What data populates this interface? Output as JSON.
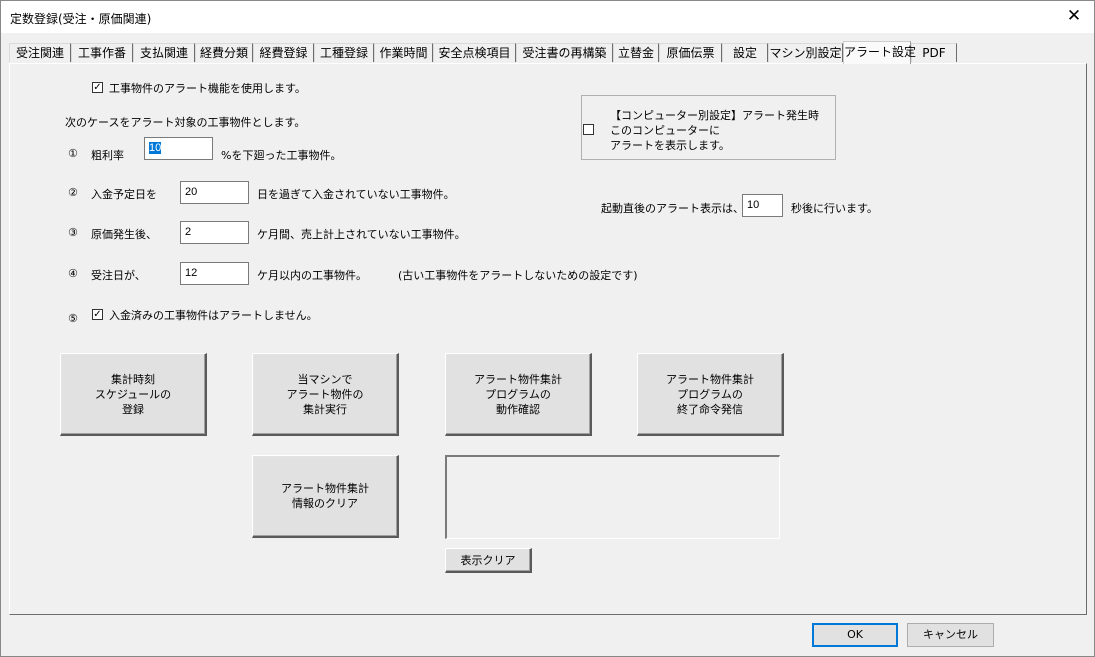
{
  "window": {
    "title": "定数登録(受注・原価関連)",
    "close_glyph": "✕"
  },
  "tabs": [
    {
      "label": "受注関連"
    },
    {
      "label": "工事作番"
    },
    {
      "label": "支払関連"
    },
    {
      "label": "経費分類"
    },
    {
      "label": "経費登録"
    },
    {
      "label": "工種登録"
    },
    {
      "label": "作業時間"
    },
    {
      "label": "安全点検項目"
    },
    {
      "label": "受注書の再構築"
    },
    {
      "label": "立替金"
    },
    {
      "label": "原価伝票"
    },
    {
      "label": "設定"
    },
    {
      "label": "マシン別設定"
    },
    {
      "label": "アラート設定",
      "active": true
    },
    {
      "label": "PDF"
    }
  ],
  "alert": {
    "enable_label": "工事物件のアラート機能を使用します。",
    "enable_checked": true,
    "cases_intro": "次のケースをアラート対象の工事物件とします。",
    "case1": {
      "num": "①",
      "label": "粗利率",
      "value": "10",
      "suffix": "%を下廻った工事物件。"
    },
    "case2": {
      "num": "②",
      "label": "入金予定日を",
      "value": "20",
      "suffix": "日を過ぎて入金されていない工事物件。"
    },
    "case3": {
      "num": "③",
      "label": "原価発生後、",
      "value": "2",
      "suffix": "ケ月間、売上計上されていない工事物件。"
    },
    "case4": {
      "num": "④",
      "label": "受注日が、",
      "value": "12",
      "suffix": "ケ月以内の工事物件。",
      "note": "(古い工事物件をアラートしないための設定です)"
    },
    "case5": {
      "num": "⑤",
      "label": "入金済みの工事物件はアラートしません。",
      "checked": true
    }
  },
  "computer_setting": {
    "line1": "【コンピューター別設定】アラート発生時",
    "line2": "このコンピューターに",
    "line3": "アラートを表示します。",
    "checked": false
  },
  "startup": {
    "prefix": "起動直後のアラート表示は、",
    "value": "10",
    "suffix": "秒後に行います。"
  },
  "buttons": {
    "schedule": "集計時刻\nスケジュールの\n登録",
    "run_local": "当マシンで\nアラート物件の\n集計実行",
    "check_program": "アラート物件集計\nプログラムの\n動作確認",
    "stop_program": "アラート物件集計\nプログラムの\n終了命令発信",
    "clear_info": "アラート物件集計\n情報のクリア",
    "clear_display": "表示クリア"
  },
  "footer": {
    "ok": "OK",
    "cancel": "キャンセル"
  },
  "colors": {
    "selection": "#0078d7",
    "face": "#f0f0f0"
  }
}
